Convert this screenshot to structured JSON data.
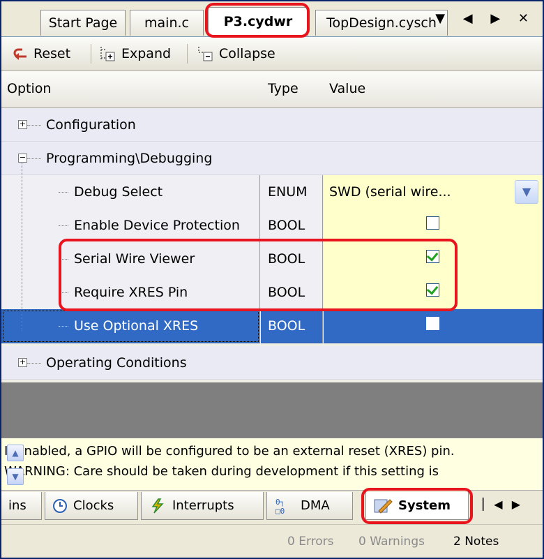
{
  "doc_tabs": [
    {
      "label": "Start Page",
      "active": false
    },
    {
      "label": "main.c",
      "active": false
    },
    {
      "label": "P3.cydwr",
      "active": true
    },
    {
      "label": "TopDesign.cysch",
      "active": false
    }
  ],
  "tab_controls": "▼ ◀ ▶ ✕",
  "toolbar": {
    "reset_label": "Reset",
    "expand_label": "Expand",
    "collapse_label": "Collapse"
  },
  "grid": {
    "headers": {
      "option": "Option",
      "type": "Type",
      "value": "Value"
    },
    "categories": {
      "configuration": "Configuration",
      "programming": "Programming\\Debugging",
      "operating": "Operating Conditions"
    },
    "rows": [
      {
        "option": "Debug Select",
        "type": "ENUM",
        "value": "SWD  (serial  wire...",
        "kind": "dropdown"
      },
      {
        "option": "Enable Device Protection",
        "type": "BOOL",
        "checked": false
      },
      {
        "option": "Serial Wire Viewer",
        "type": "BOOL",
        "checked": true
      },
      {
        "option": "Require XRES Pin",
        "type": "BOOL",
        "checked": true
      },
      {
        "option": "Use Optional XRES",
        "type": "BOOL",
        "checked": false,
        "selected": true
      }
    ]
  },
  "description": {
    "line1": "If enabled, a GPIO will be configured to be an external reset (XRES) pin.",
    "line2": "WARNING: Care should be taken during development if this setting is"
  },
  "bottom_tabs": [
    {
      "label": "ins",
      "icon": "pins-icon"
    },
    {
      "label": "Clocks",
      "icon": "clock-icon"
    },
    {
      "label": "Interrupts",
      "icon": "interrupt-icon"
    },
    {
      "label": "DMA",
      "icon": "dma-icon"
    },
    {
      "label": "System",
      "icon": "system-icon",
      "active": true
    }
  ],
  "status": {
    "errors": "0 Errors",
    "warnings": "0 Warnings",
    "notes": "2 Notes"
  },
  "colors": {
    "highlight": "#e8141e",
    "selection": "#316ac5",
    "value_bg": "#ffffcc"
  }
}
